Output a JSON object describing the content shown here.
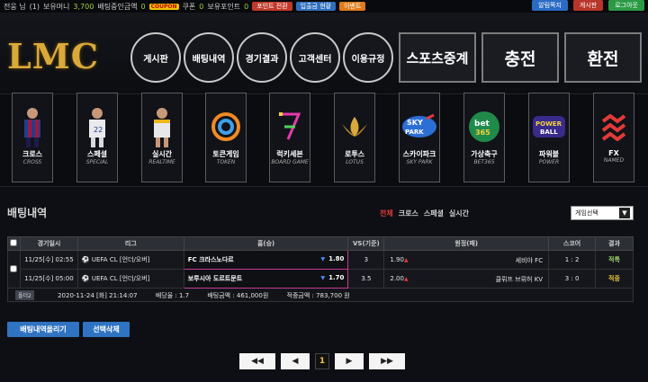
{
  "topbar": {
    "items": [
      "전웅 님",
      "(1)",
      "보유머니",
      "3,700",
      "배팅중인금액",
      "0",
      "쿠폰",
      "0",
      "보유포인트",
      "0"
    ],
    "coupon_logo": "COUPON",
    "buttons": [
      "포인트 전환",
      "입출금 현황",
      "이벤트"
    ],
    "right_buttons": [
      "알림쪽지",
      "게시판",
      "로그아웃"
    ]
  },
  "logo": "LMC",
  "nav": [
    "게시판",
    "배팅내역",
    "경기결과",
    "고객센터",
    "이용규정"
  ],
  "big_buttons": [
    "스포츠중계",
    "충전",
    "환전"
  ],
  "games": [
    {
      "ko": "크로스",
      "en": "CROSS",
      "icon": "soccer-player"
    },
    {
      "ko": "스페셜",
      "en": "SPECIAL",
      "icon": "baseball-player"
    },
    {
      "ko": "실시간",
      "en": "REALTIME",
      "icon": "basketball-player"
    },
    {
      "ko": "토큰게임",
      "en": "TOKEN",
      "icon": "token-logo"
    },
    {
      "ko": "럭키세븐",
      "en": "BOARD GAME",
      "icon": "lucky-seven-logo"
    },
    {
      "ko": "로투스",
      "en": "LOTUS",
      "icon": "lotus-logo"
    },
    {
      "ko": "스카이파크",
      "en": "SKY PARK",
      "icon": "skypark-logo"
    },
    {
      "ko": "가상축구",
      "en": "BET365",
      "icon": "bet365-logo"
    },
    {
      "ko": "파워볼",
      "en": "POWER",
      "icon": "powerball-logo"
    },
    {
      "ko": "FX",
      "en": "NAMED",
      "icon": "fx-logo"
    }
  ],
  "section": {
    "title": "배팅내역",
    "filters": [
      "전체",
      "크로스",
      "스페셜",
      "실시간"
    ],
    "select": "게임선택"
  },
  "table": {
    "headers": [
      "경기일시",
      "리그",
      "홈(승)",
      "VS(기준)",
      "원정(패)",
      "스코어",
      "결과"
    ],
    "rows": [
      {
        "date": "11/25[수] 02:55",
        "league": "UEFA CL [언더/오버]",
        "home": "FC 크라스노다르",
        "home_odd": "1.80",
        "vs": "3",
        "away_odd": "1.90",
        "away": "세비야 FC",
        "score": "1 : 2",
        "result": "적특"
      },
      {
        "date": "11/25[수] 05:00",
        "league": "UEFA CL [언더/오버]",
        "home": "보루시아 도르트문트",
        "home_odd": "1.70",
        "vs": "3.5",
        "away_odd": "2.00",
        "away": "클뤼프 브뤼허 KV",
        "score": "3 : 0",
        "result": "적중"
      }
    ],
    "summary": {
      "badge": "폴더2",
      "datetime": "2020-11-24 [화] 21:14:07",
      "odds": "배당율 : 1.7",
      "bet": "배팅금액 : 461,000원",
      "win": "적중금액 : 783,700 원"
    }
  },
  "actions": [
    "배팅내역올리기",
    "선택삭제"
  ],
  "pager": {
    "first": "◀◀",
    "prev": "◀",
    "current": "1",
    "next": "▶",
    "last": "▶▶"
  }
}
